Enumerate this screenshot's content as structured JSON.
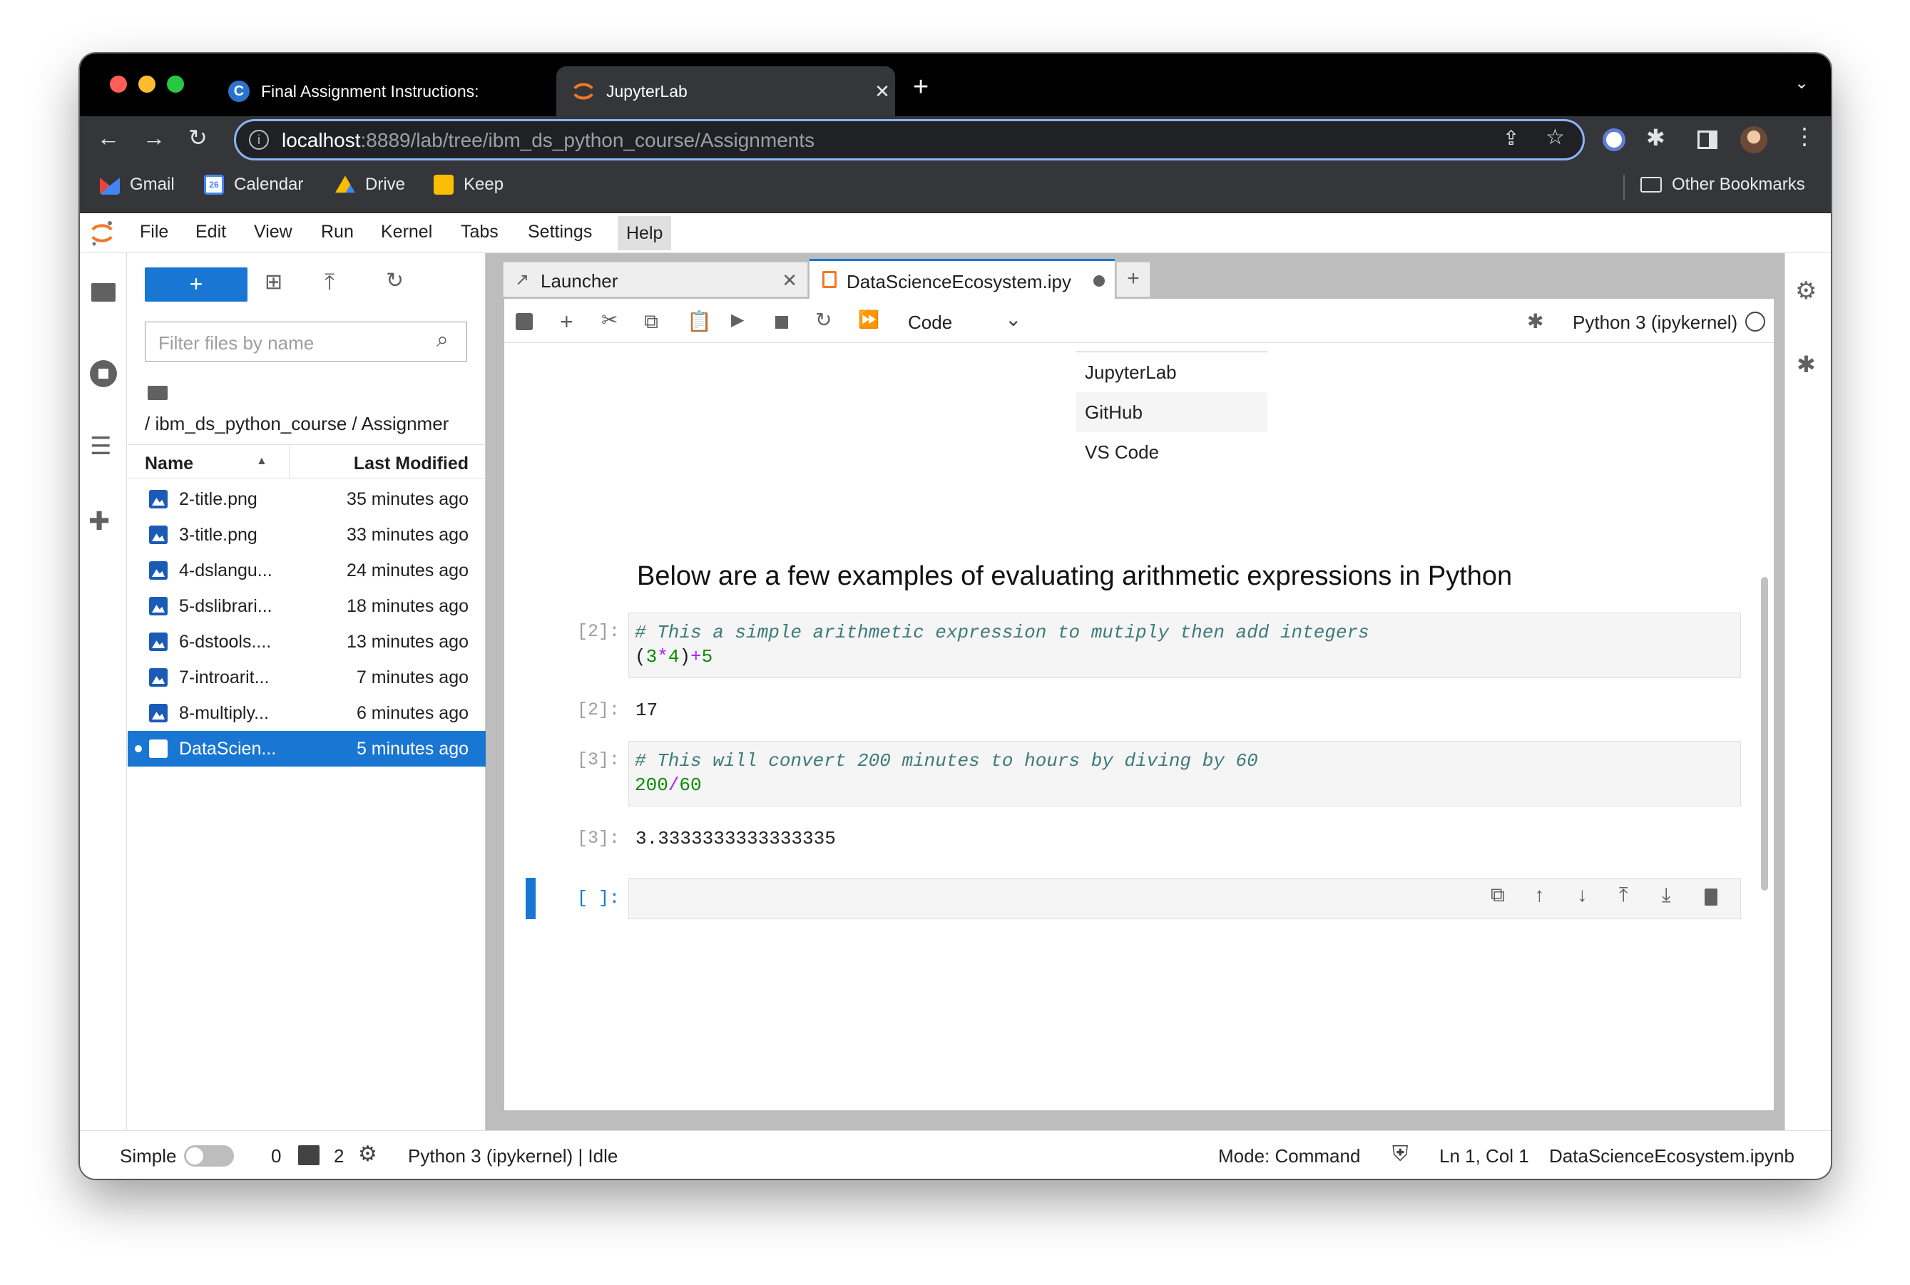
{
  "browser": {
    "tabs": [
      {
        "title": "Final Assignment Instructions:",
        "favicon": "coursera-icon"
      },
      {
        "title": "JupyterLab",
        "favicon": "jupyter-icon"
      }
    ],
    "url_host": "localhost",
    "url_rest": ":8889/lab/tree/ibm_ds_python_course/Assignments",
    "bookmarks": [
      "Gmail",
      "Calendar",
      "Drive",
      "Keep"
    ],
    "calendar_day": "26",
    "other_bookmarks": "Other Bookmarks"
  },
  "jupyter": {
    "menus": [
      "File",
      "Edit",
      "View",
      "Run",
      "Kernel",
      "Tabs",
      "Settings",
      "Help"
    ],
    "active_menu": "Help",
    "filter_placeholder": "Filter files by name",
    "breadcrumb": "/ ibm_ds_python_course / Assignmer",
    "columns": {
      "name": "Name",
      "modified": "Last Modified"
    },
    "files": [
      {
        "name": "2-title.png",
        "modified": "35 minutes ago"
      },
      {
        "name": "3-title.png",
        "modified": "33 minutes ago"
      },
      {
        "name": "4-dslangu...",
        "modified": "24 minutes ago"
      },
      {
        "name": "5-dslibrari...",
        "modified": "18 minutes ago"
      },
      {
        "name": "6-dstools....",
        "modified": "13 minutes ago"
      },
      {
        "name": "7-introarit...",
        "modified": "7 minutes ago"
      },
      {
        "name": "8-multiply...",
        "modified": "6 minutes ago"
      },
      {
        "name": "DataScien...",
        "modified": "5 minutes ago",
        "selected": true
      }
    ],
    "doc_tabs": [
      {
        "title": "Launcher"
      },
      {
        "title": "DataScienceEcosystem.ipy",
        "modified": true
      }
    ],
    "cell_type": "Code",
    "kernel_name": "Python 3 (ipykernel)",
    "table_rows": [
      "JupyterLab",
      "GitHub",
      "VS Code"
    ],
    "heading": "Below are a few examples of evaluating arithmetic expressions in Python",
    "cells": [
      {
        "in_prompt": "[2]:",
        "comment": "# This a simple arithmetic expression to mutiply then add integers",
        "out_prompt": "[2]:",
        "output": "17"
      },
      {
        "in_prompt": "[3]:",
        "comment": "# This will convert 200 minutes to hours by diving by 60",
        "out_prompt": "[3]:",
        "output": "3.3333333333333335"
      }
    ],
    "code1": {
      "p1": "(",
      "n1": "3",
      "op1": "*",
      "n2": "4",
      "p2": ")",
      "op2": "+",
      "n3": "5"
    },
    "code2": {
      "n1": "200",
      "op": "/",
      "n2": "60"
    },
    "empty_prompt": "[ ]:",
    "status": {
      "mode_label": "Simple",
      "terminals": "0",
      "kernels": "2",
      "kernel_status": "Python 3 (ipykernel) | Idle",
      "mode": "Mode: Command",
      "cursor": "Ln 1, Col 1",
      "filename": "DataScienceEcosystem.ipynb"
    }
  },
  "colors": {
    "accent": "#1976d2",
    "selected_row": "#1976d2",
    "jupyter_orange": "#f37726"
  }
}
